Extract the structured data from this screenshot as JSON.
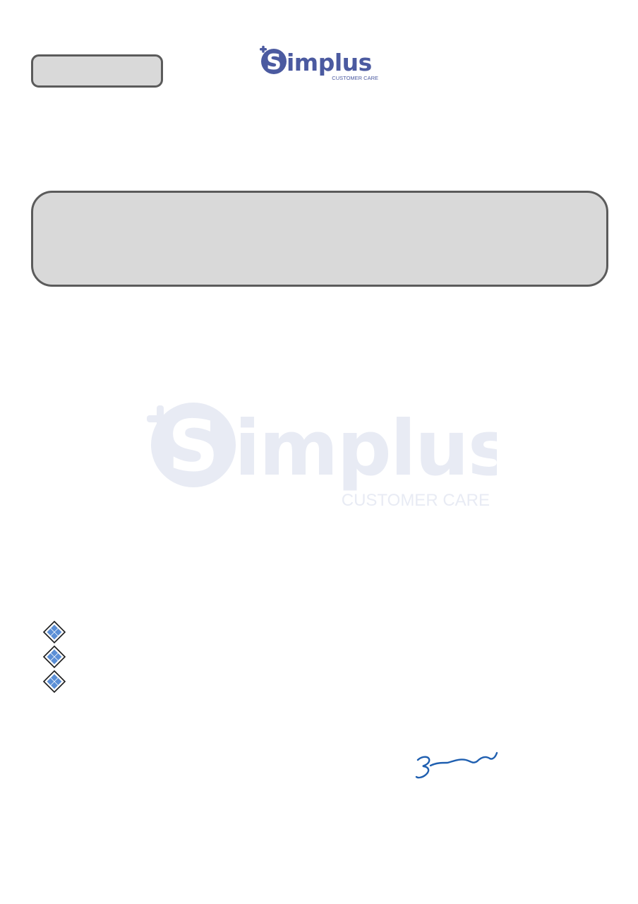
{
  "header": {
    "brand_name": "Simplus",
    "brand_tagline": "CUSTOMER CARE",
    "brand_color": "#4b5aa0",
    "logo_icon": "plus-s-logo-icon"
  },
  "top_box": {
    "fill_color": "#d9d9d9",
    "border_color": "#5b5b5b"
  },
  "main_box": {
    "fill_color": "#d9d9d9",
    "border_color": "#5b5b5b"
  },
  "watermark": {
    "brand_name": "Simplus",
    "brand_tagline": "CUSTOMER CARE",
    "color": "#e8ebf4"
  },
  "bullets": {
    "icon": "diamond-bullet-icon",
    "count": 3,
    "color": "#5b8fd6"
  },
  "signature": {
    "icon": "handwritten-signature",
    "ink_color": "#1f5fb0"
  }
}
